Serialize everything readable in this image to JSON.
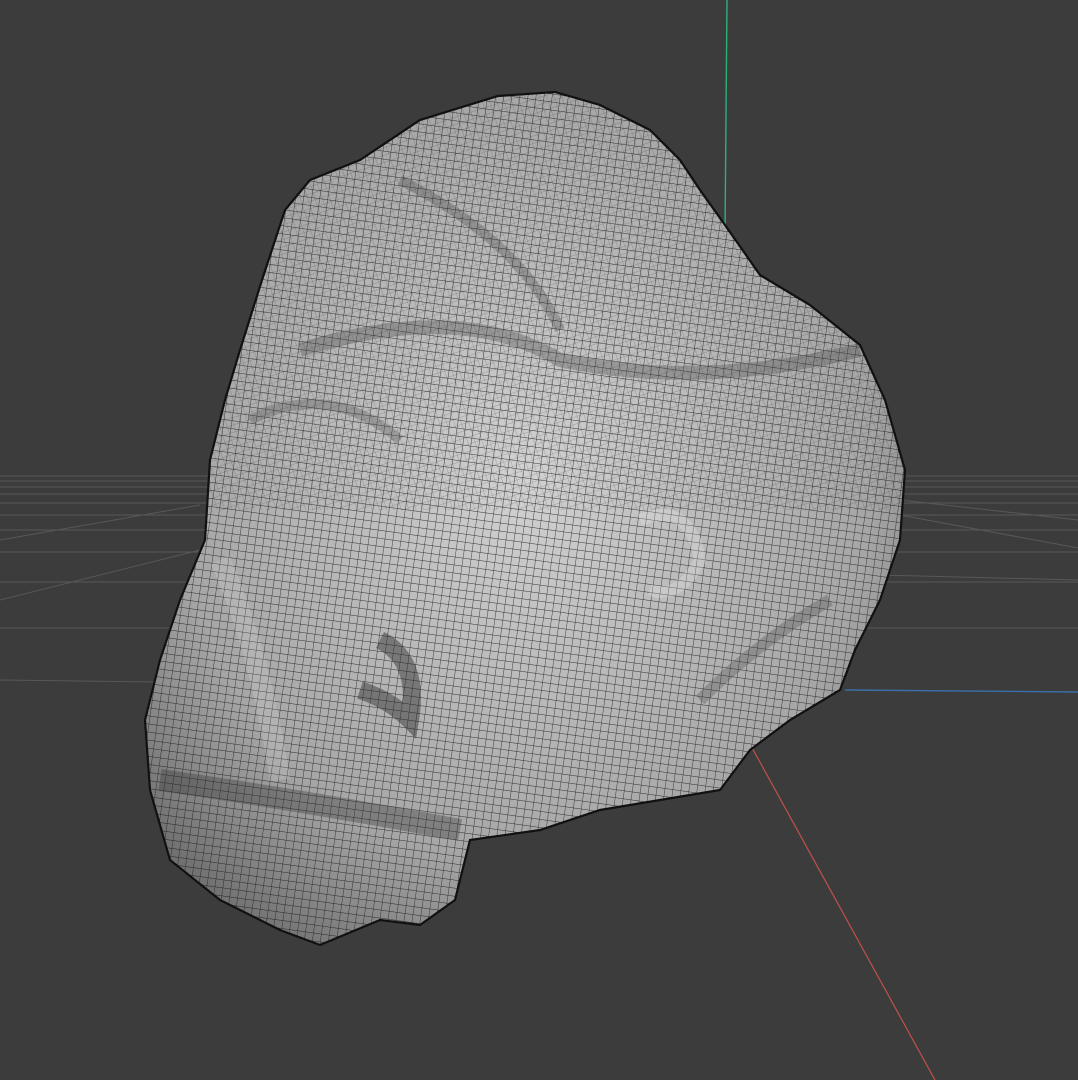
{
  "viewport": {
    "view": "perspective",
    "shading": "wireframe-on-shaded",
    "background_color": "#3c3c3c",
    "grid_color": "#5a5a5a",
    "axes": {
      "x_color": "#c0504d",
      "y_color": "#2fb07a",
      "z_color": "#3b6ea8"
    },
    "mesh": {
      "object": "rock",
      "fill_color": "#b4b4b4",
      "wire_color": "#1a1a1a"
    }
  }
}
